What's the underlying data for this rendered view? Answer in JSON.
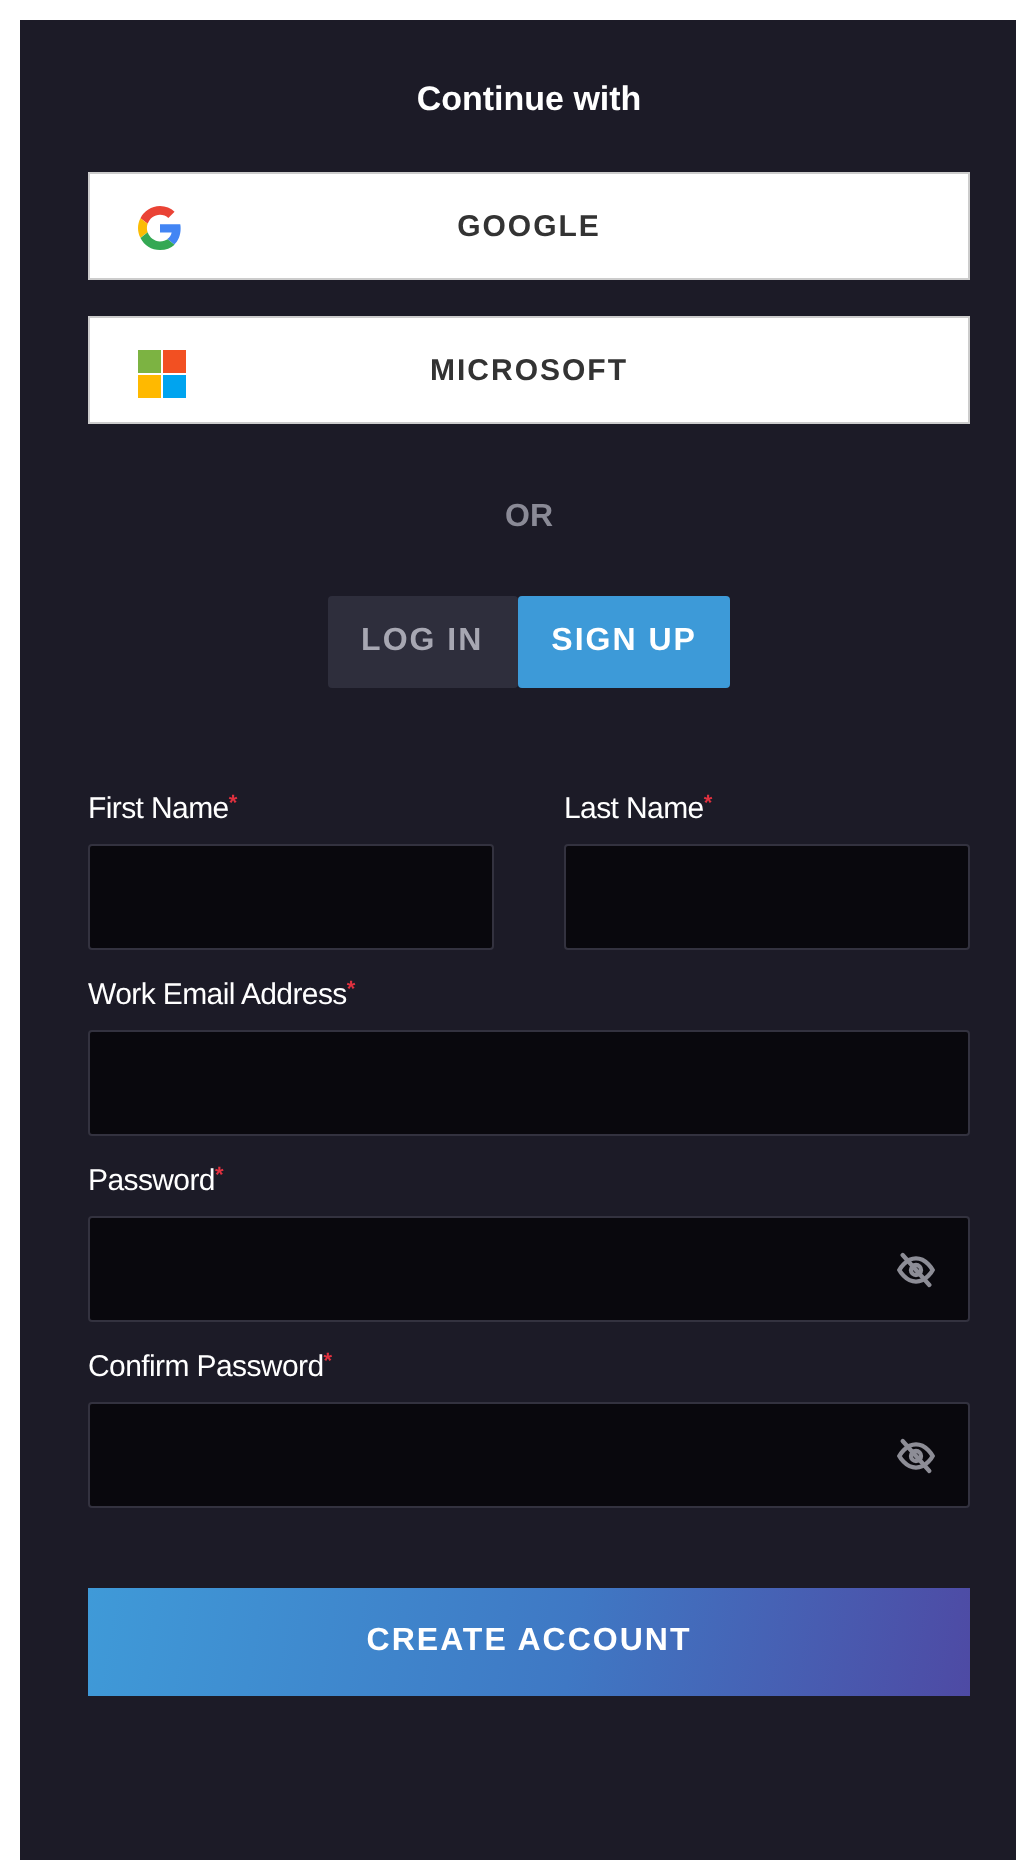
{
  "heading": "Continue with",
  "providers": [
    {
      "kind": "google",
      "label": "GOOGLE"
    },
    {
      "kind": "microsoft",
      "label": "MICROSOFT"
    }
  ],
  "divider_text": "OR",
  "tabs": [
    {
      "label": "LOG IN",
      "selected": false
    },
    {
      "label": "SIGN UP",
      "selected": true
    }
  ],
  "form_rows": [
    {
      "fields": [
        {
          "label": "First Name",
          "required_mark": "*"
        },
        {
          "label": "Last Name",
          "required_mark": "*"
        }
      ]
    },
    {
      "fields": [
        {
          "label": "Work Email Address",
          "required_mark": "*"
        }
      ]
    },
    {
      "fields": [
        {
          "label": "Password",
          "required_mark": "*",
          "password_hidden": true
        }
      ]
    },
    {
      "fields": [
        {
          "label": "Confirm Password",
          "required_mark": "*",
          "password_hidden": true
        }
      ]
    }
  ],
  "submit_button": "CREATE ACCOUNT"
}
